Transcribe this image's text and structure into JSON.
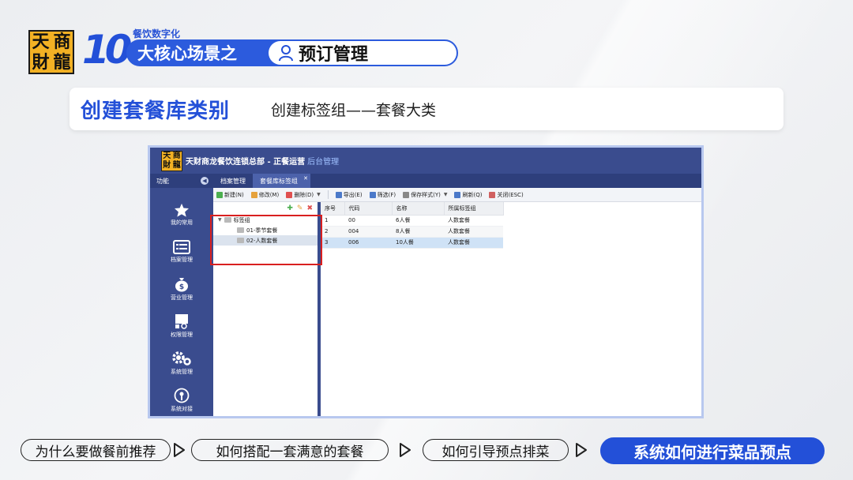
{
  "header": {
    "logo_chars": [
      "天",
      "商",
      "財",
      "龍"
    ],
    "big_number": "10",
    "kicker": "餐饮数字化",
    "banner_left": "大核心场景之",
    "banner_right": "预订管理"
  },
  "titlebar": {
    "main": "创建套餐库类别",
    "sub": "创建标签组——套餐大类"
  },
  "app": {
    "logo_chars": [
      "天",
      "商",
      "財",
      "龍"
    ],
    "title": "天财商龙餐饮连锁总部 - 正餐运营",
    "title_sub": "后台管理",
    "nav": {
      "func_label": "功能",
      "tabs": [
        "档案管理",
        "套餐库标签组"
      ]
    },
    "sidebar": [
      {
        "label": "我的常用",
        "icon": "star-icon"
      },
      {
        "label": "档案管理",
        "icon": "archive-icon"
      },
      {
        "label": "营业管理",
        "icon": "money-bag-icon"
      },
      {
        "label": "权限管理",
        "icon": "permission-icon"
      },
      {
        "label": "系统管理",
        "icon": "gear-icon"
      },
      {
        "label": "系统对接",
        "icon": "link-icon"
      }
    ],
    "toolbar": [
      {
        "label": "新建(N)",
        "color": "#4caf50"
      },
      {
        "label": "修改(M)",
        "color": "#e6a23c"
      },
      {
        "label": "删除(D)",
        "color": "#e05050",
        "dropdown": true
      },
      {
        "label": "导出(E)",
        "color": "#4b79c9"
      },
      {
        "label": "筛选(F)",
        "color": "#4b79c9"
      },
      {
        "label": "保存样式(Y)",
        "color": "#888888",
        "dropdown": true
      },
      {
        "label": "刷新(Q)",
        "color": "#4b79c9"
      },
      {
        "label": "关闭(ESC)",
        "color": "#d06060"
      }
    ],
    "tree": {
      "root": "标签组",
      "children": [
        "01-季节套餐",
        "02-人数套餐"
      ]
    },
    "grid": {
      "headers": [
        "序号",
        "代码",
        "名称",
        "所属标签组"
      ],
      "rows": [
        [
          "1",
          "00",
          "6人餐",
          "人数套餐"
        ],
        [
          "2",
          "004",
          "8人餐",
          "人数套餐"
        ],
        [
          "3",
          "006",
          "10人餐",
          "人数套餐"
        ]
      ]
    }
  },
  "flow": {
    "steps": [
      "为什么要做餐前推荐",
      "如何搭配一套满意的套餐",
      "如何引导预点排菜",
      "系统如何进行菜品预点"
    ]
  },
  "colors": {
    "brand_blue": "#2350d8",
    "logo_yellow": "#f2b124",
    "app_navy": "#3a4c8e",
    "highlight_red": "#d91f1f"
  }
}
